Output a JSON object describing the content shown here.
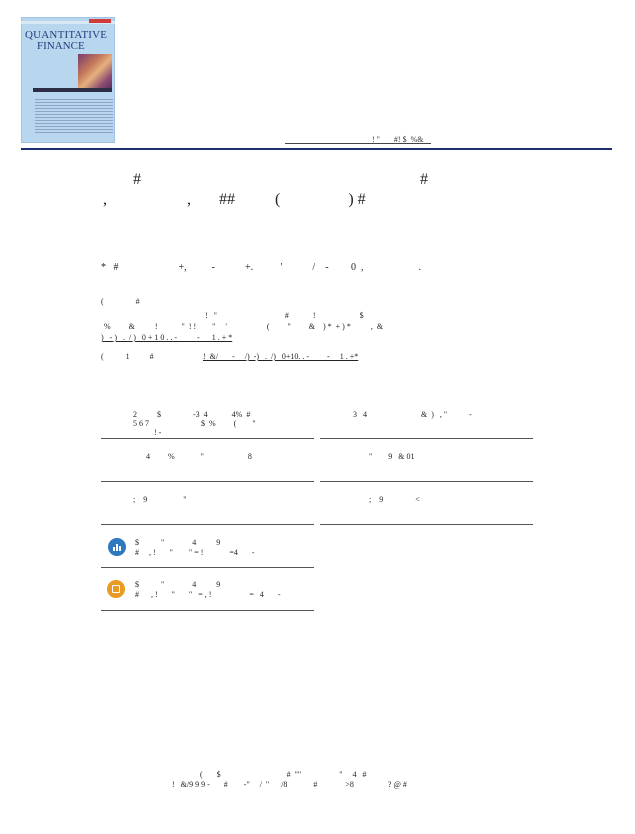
{
  "cover": {
    "title_line1": "QUANTITATIVE",
    "title_line2": "FINANCE"
  },
  "publisher_line": "! \"       #! $  %&",
  "title": {
    "line1_left": "#",
    "line1_right": "#",
    "line2": ",                    ,       ##          (                 ) #"
  },
  "authors": "*   #                        +,          -            +.           '            /    -         0  ,                      .",
  "meta": {
    "line1": "(                #",
    "line2": "!   \"                                  #            !                      $",
    "line3": "%         &          !            \"  ! !        \"     '                    (         \"         &    ) *  + ) *          ,  &",
    "line4": ")   - )   .  / )   0 + 1 0 . . -          -      1 . + *",
    "line5_label": "(           1          #",
    "line5_link": "!  &/       -     /)  -)   .  /)   0+10. . -         -     1 . +*"
  },
  "cite": {
    "col1": "2          $                -3  4            4%  #",
    "col1b": "5 6 7                          $  %         (        \"",
    "col1c": "! -",
    "col2": "3   4                           &  )   , \"           -"
  },
  "cells": {
    "r1c1": "4         %             \"                      8",
    "r1c2": "\"        9   & 01",
    "r2c1": ";    9                  \"",
    "r2c2": ";    9                <"
  },
  "metrics": [
    {
      "line1": "$           \"              4          9",
      "line2": "#     , !       \"        \" = !             =4       -",
      "color": "#2f78bf",
      "icon": "bar-chart-icon"
    },
    {
      "line1": "$           \"              4          9",
      "line2": "#      , !       \"       \"   = , !                   =   4       -",
      "color": "#e89a24",
      "icon": "box-icon"
    }
  ],
  "footer": {
    "line1": "(       $                                 #  \"\"                   \"     4   #",
    "line2": "!   &/9 9 9 -       #        -\"     /  \"      /8             #              >8                 ? @ #"
  }
}
